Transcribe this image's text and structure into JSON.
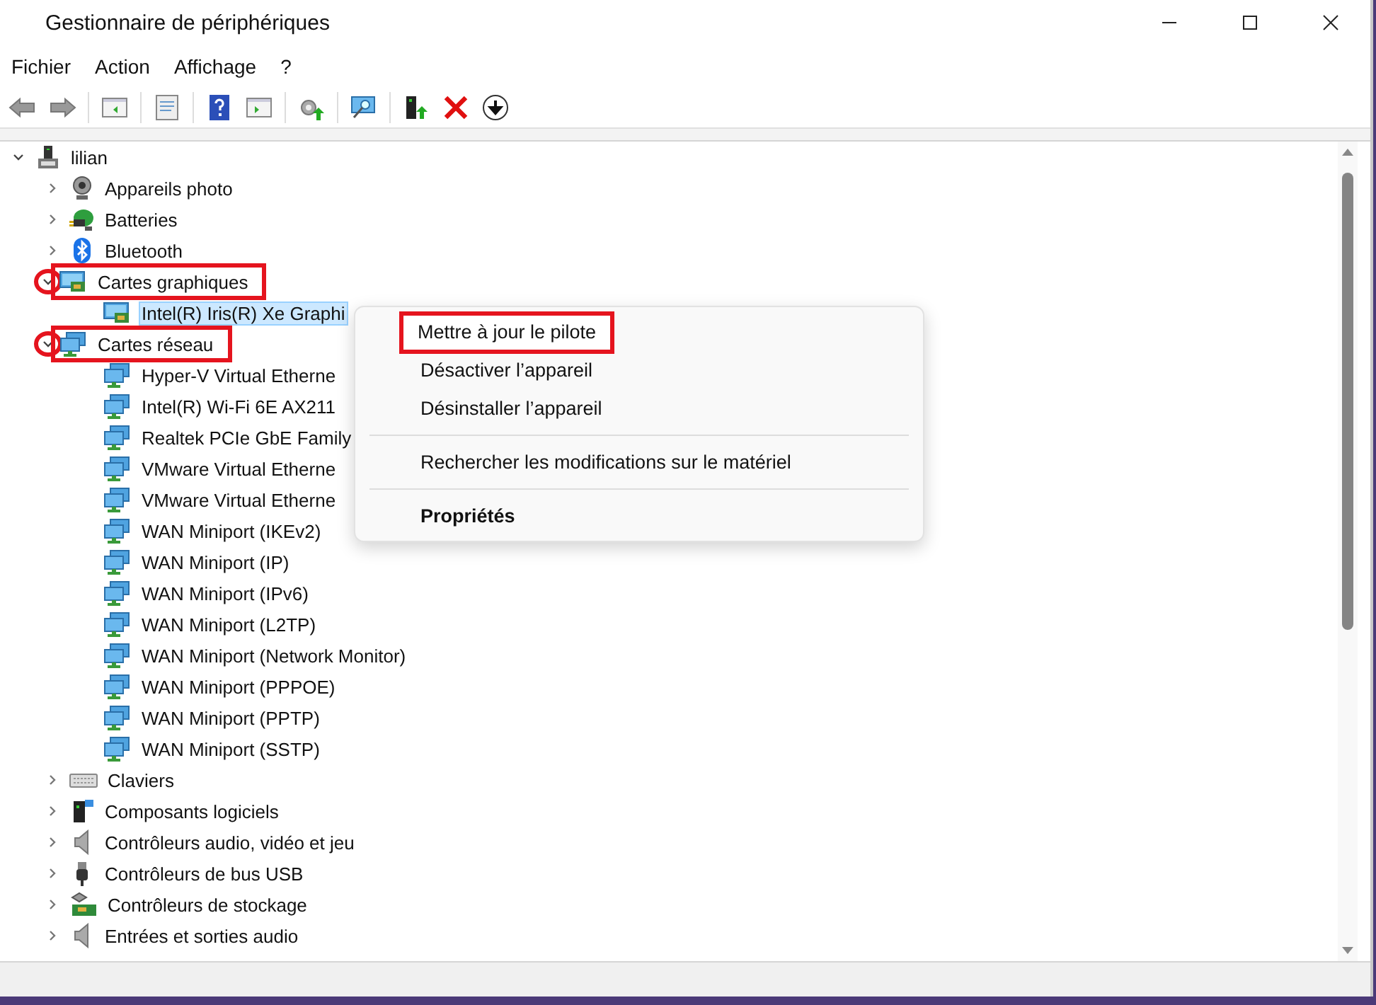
{
  "window": {
    "title": "Gestionnaire de périphériques"
  },
  "menu_bar": [
    "Fichier",
    "Action",
    "Affichage",
    "?"
  ],
  "tree": [
    {
      "label": "lilian",
      "kind": "computer",
      "expanded": true,
      "selected": false,
      "annotated": false,
      "children": [
        {
          "label": "Appareils photo",
          "kind": "camera",
          "expanded": false,
          "selected": false,
          "annotated": false
        },
        {
          "label": "Batteries",
          "kind": "battery",
          "expanded": false,
          "selected": false,
          "annotated": false
        },
        {
          "label": "Bluetooth",
          "kind": "bluetooth",
          "expanded": false,
          "selected": false,
          "annotated": false
        },
        {
          "label": "Cartes graphiques",
          "kind": "display",
          "expanded": true,
          "selected": false,
          "annotated": true,
          "children": [
            {
              "label": "Intel(R) Iris(R) Xe Graphi",
              "kind": "display",
              "selected": true,
              "annotated": false
            }
          ]
        },
        {
          "label": "Cartes réseau",
          "kind": "network",
          "expanded": true,
          "selected": false,
          "annotated": true,
          "children": [
            {
              "label": "Hyper-V Virtual Etherne",
              "kind": "network",
              "selected": false,
              "annotated": false
            },
            {
              "label": "Intel(R) Wi-Fi 6E AX211",
              "kind": "network",
              "selected": false,
              "annotated": false
            },
            {
              "label": "Realtek PCIe GbE Family",
              "kind": "network",
              "selected": false,
              "annotated": false
            },
            {
              "label": "VMware Virtual Etherne",
              "kind": "network",
              "selected": false,
              "annotated": false
            },
            {
              "label": "VMware Virtual Etherne",
              "kind": "network",
              "selected": false,
              "annotated": false
            },
            {
              "label": "WAN Miniport (IKEv2)",
              "kind": "network",
              "selected": false,
              "annotated": false
            },
            {
              "label": "WAN Miniport (IP)",
              "kind": "network",
              "selected": false,
              "annotated": false
            },
            {
              "label": "WAN Miniport (IPv6)",
              "kind": "network",
              "selected": false,
              "annotated": false
            },
            {
              "label": "WAN Miniport (L2TP)",
              "kind": "network",
              "selected": false,
              "annotated": false
            },
            {
              "label": "WAN Miniport (Network Monitor)",
              "kind": "network",
              "selected": false,
              "annotated": false
            },
            {
              "label": "WAN Miniport (PPPOE)",
              "kind": "network",
              "selected": false,
              "annotated": false
            },
            {
              "label": "WAN Miniport (PPTP)",
              "kind": "network",
              "selected": false,
              "annotated": false
            },
            {
              "label": "WAN Miniport (SSTP)",
              "kind": "network",
              "selected": false,
              "annotated": false
            }
          ]
        },
        {
          "label": "Claviers",
          "kind": "keyboard",
          "expanded": false,
          "selected": false,
          "annotated": false
        },
        {
          "label": "Composants logiciels",
          "kind": "software",
          "expanded": false,
          "selected": false,
          "annotated": false
        },
        {
          "label": "Contrôleurs audio, vidéo et jeu",
          "kind": "audio",
          "expanded": false,
          "selected": false,
          "annotated": false
        },
        {
          "label": "Contrôleurs de bus USB",
          "kind": "usb",
          "expanded": false,
          "selected": false,
          "annotated": false
        },
        {
          "label": "Contrôleurs de stockage",
          "kind": "storage",
          "expanded": false,
          "selected": false,
          "annotated": false
        },
        {
          "label": "Entrées et sorties audio",
          "kind": "audio",
          "expanded": false,
          "selected": false,
          "annotated": false
        }
      ]
    }
  ],
  "context_menu": {
    "groups": [
      [
        {
          "label": "Mettre à jour le pilote",
          "default": false,
          "annotated": true
        },
        {
          "label": "Désactiver l’appareil",
          "default": false,
          "annotated": false
        },
        {
          "label": "Désinstaller l’appareil",
          "default": false,
          "annotated": false
        }
      ],
      [
        {
          "label": "Rechercher les modifications sur le matériel",
          "default": false,
          "annotated": false
        }
      ],
      [
        {
          "label": "Propriétés",
          "default": true,
          "annotated": false
        }
      ]
    ]
  }
}
